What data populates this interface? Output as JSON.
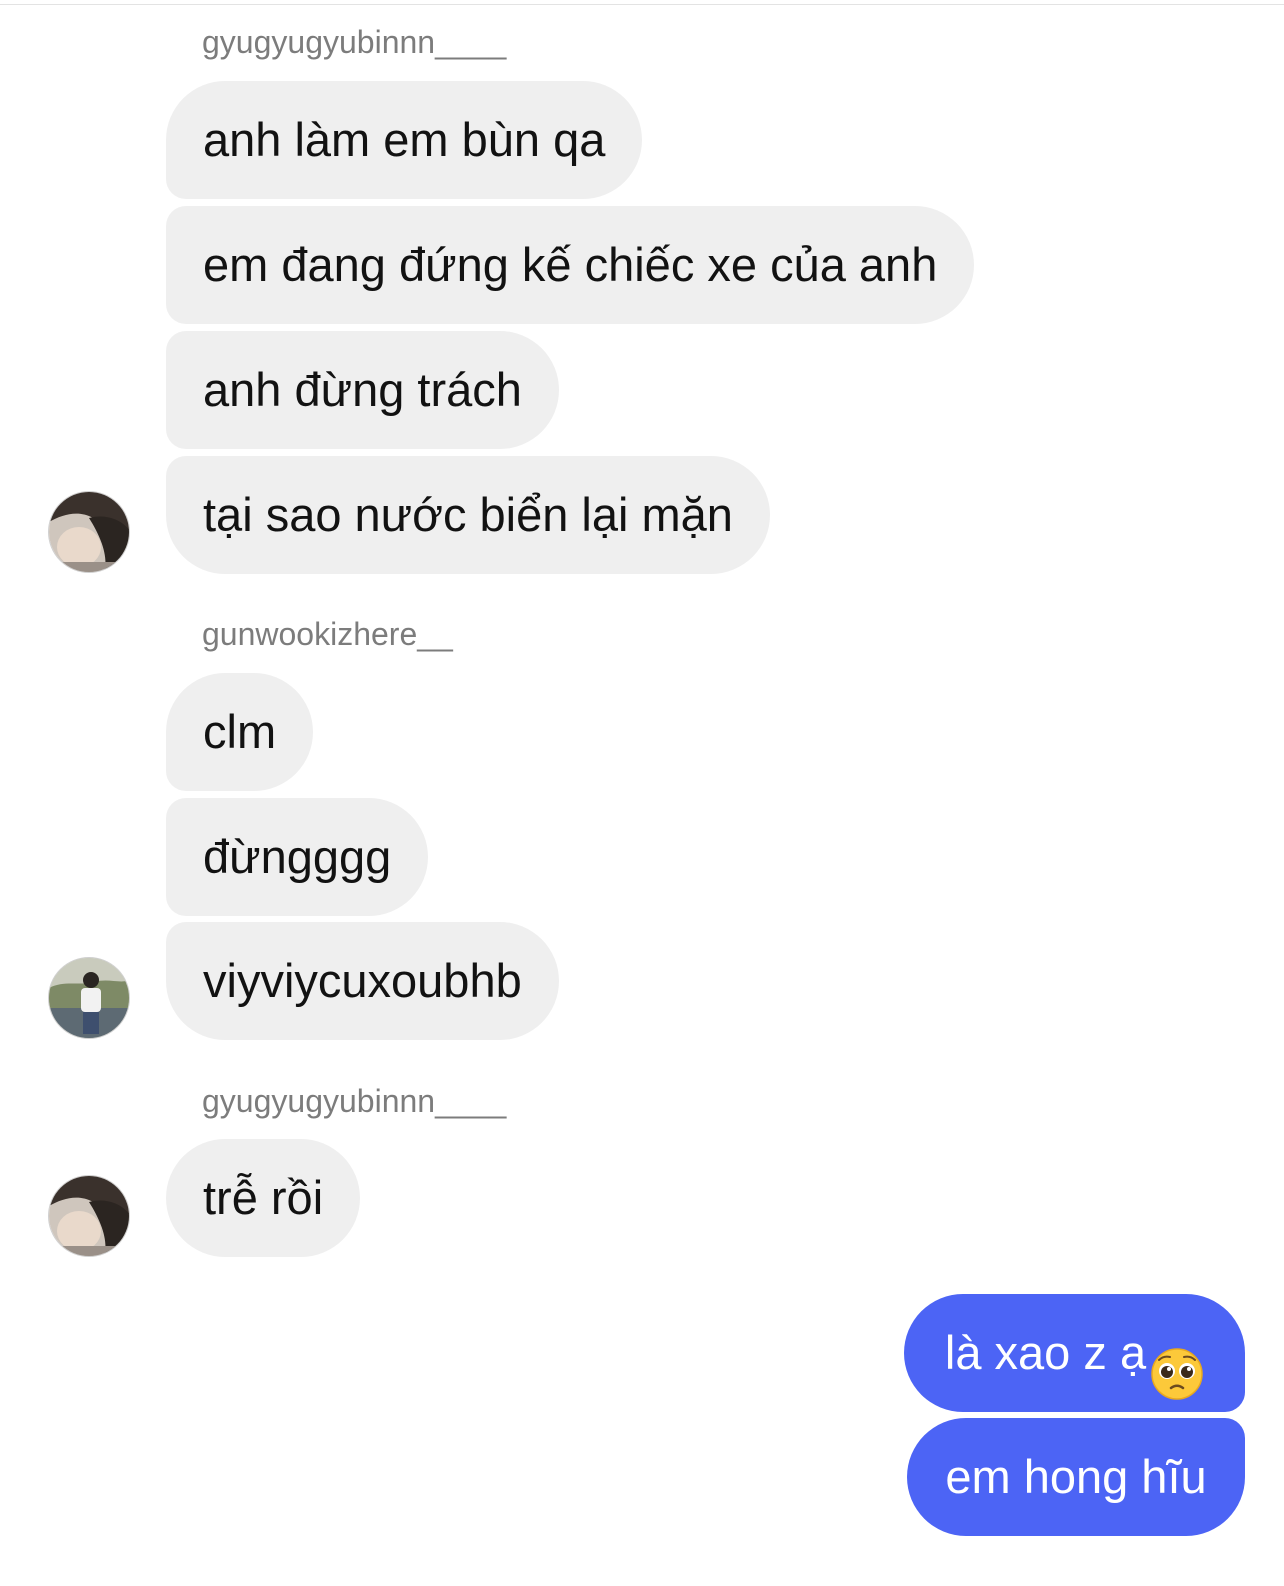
{
  "messages": [
    {
      "sender": "gyugyugyubinnn____",
      "texts": [
        "anh làm em bùn qa",
        "em đang đứng kế chiếc xe của anh",
        "anh đừng trách",
        "tại sao nước biển lại mặn"
      ],
      "avatar": "user-avatar-photo"
    },
    {
      "sender": "gunwookizhere__",
      "texts": [
        "clm",
        "đừngggg",
        "viyviycuxoubhb"
      ],
      "avatar": "user-avatar-photo"
    },
    {
      "sender": "gyugyugyubinnn____",
      "texts": [
        "trễ rồi"
      ],
      "avatar": "user-avatar-photo"
    }
  ],
  "outgoing": {
    "texts": [
      "là xao z ạ",
      "em hong hĩu"
    ],
    "emoji": "pleading-face-emoji"
  },
  "colors": {
    "incoming_bubble": "#efefef",
    "outgoing_bubble": "#4c64f5",
    "sender_name": "#7c7c7c"
  }
}
